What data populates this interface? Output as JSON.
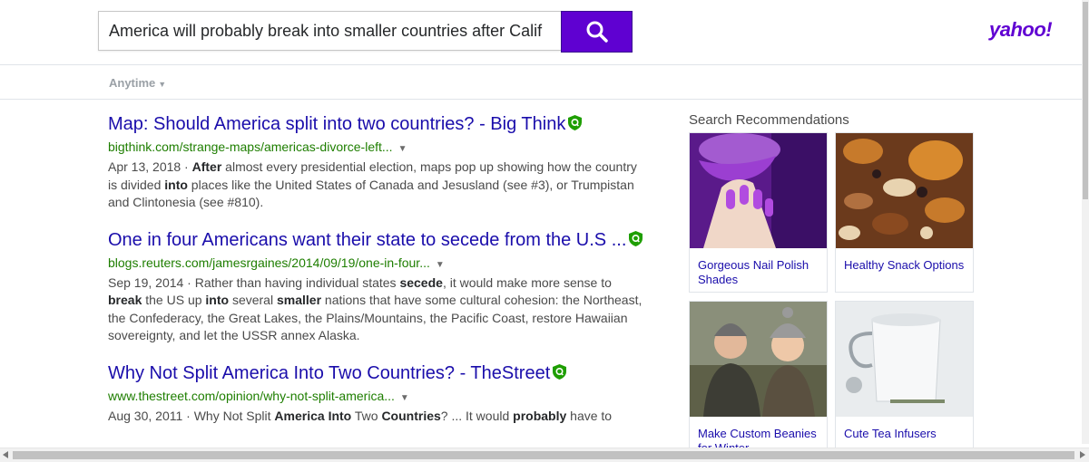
{
  "search": {
    "query": "America will probably break into smaller countries after Calif",
    "button_icon": "search-icon"
  },
  "logo": {
    "text": "yahoo!"
  },
  "filters": {
    "time_label": "Anytime"
  },
  "results": [
    {
      "title": "Map: Should America split into two countries? - Big Think",
      "url": "bigthink.com/strange-maps/americas-divorce-left...",
      "date": "Apr 13, 2018",
      "snippet": [
        {
          "t": "After",
          "b": true
        },
        {
          "t": " almost every presidential election, maps pop up showing how the country is divided ",
          "b": false
        },
        {
          "t": "into",
          "b": true
        },
        {
          "t": " places like the United States of Canada and Jesusland (see #3), or Trumpistan and Clintonesia (see #810).",
          "b": false
        }
      ]
    },
    {
      "title": "One in four Americans want their state to secede from the U.S ...",
      "url": "blogs.reuters.com/jamesrgaines/2014/09/19/one-in-four...",
      "date": "Sep 19, 2014",
      "snippet": [
        {
          "t": "Rather than having individual states ",
          "b": false
        },
        {
          "t": "secede",
          "b": true
        },
        {
          "t": ", it would make more sense to ",
          "b": false
        },
        {
          "t": "break",
          "b": true
        },
        {
          "t": " the US up ",
          "b": false
        },
        {
          "t": "into",
          "b": true
        },
        {
          "t": " several ",
          "b": false
        },
        {
          "t": "smaller",
          "b": true
        },
        {
          "t": " nations that have some cultural cohesion: the Northeast, the Confederacy, the Great Lakes, the Plains/Mountains, the Pacific Coast, restore Hawaiian sovereignty, and let the USSR annex Alaska.",
          "b": false
        }
      ]
    },
    {
      "title": "Why Not Split America Into Two Countries? - TheStreet",
      "url": "www.thestreet.com/opinion/why-not-split-america...",
      "date": "Aug 30, 2011",
      "snippet": [
        {
          "t": "Why Not Split ",
          "b": false
        },
        {
          "t": "America Into",
          "b": true
        },
        {
          "t": " Two ",
          "b": false
        },
        {
          "t": "Countries",
          "b": true
        },
        {
          "t": "? ... It would ",
          "b": false
        },
        {
          "t": "probably",
          "b": true
        },
        {
          "t": " have to",
          "b": false
        }
      ]
    }
  ],
  "recommendations": {
    "title": "Search Recommendations",
    "items": [
      {
        "label": "Gorgeous Nail Polish Shades",
        "image": "purple-nails-image"
      },
      {
        "label": "Healthy Snack Options",
        "image": "mixed-nuts-image"
      },
      {
        "label": "Make Custom Beanies for Winter",
        "image": "couple-beanies-image"
      },
      {
        "label": "Cute Tea Infusers",
        "image": "tea-mug-image"
      }
    ]
  },
  "colors": {
    "accent": "#5f01d1",
    "link": "#1a0dab",
    "url": "#1e7e00",
    "shield": "#1e7e00"
  }
}
